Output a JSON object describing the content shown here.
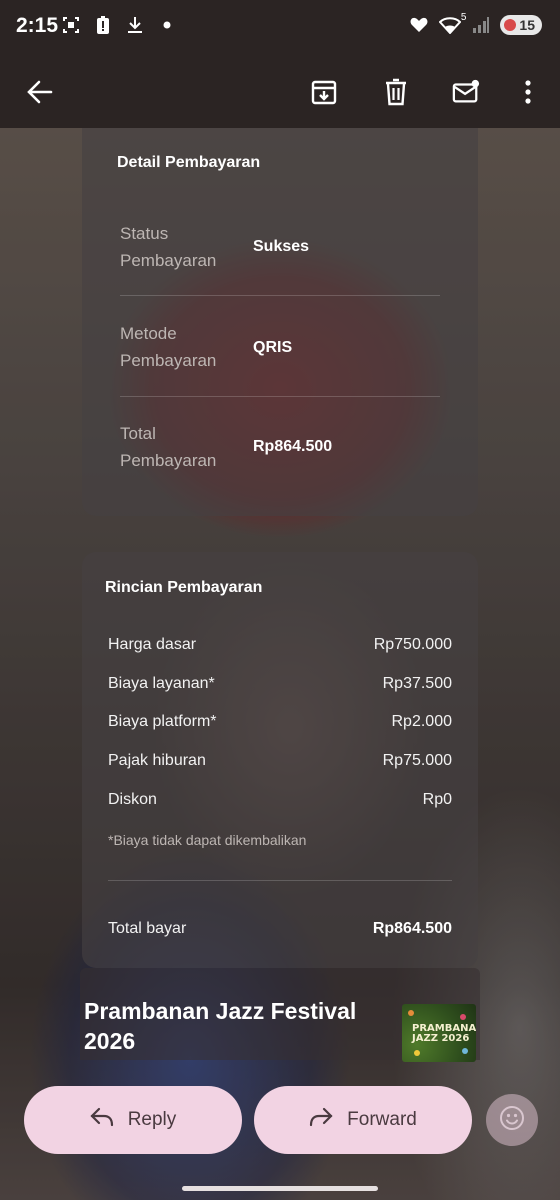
{
  "status_bar": {
    "time": "2:15",
    "battery_level": "15",
    "wifi_label": "5",
    "icons": [
      "screenshot-icon",
      "alert-battery-icon",
      "download-icon",
      "notification-dot",
      "heart-icon",
      "wifi-icon",
      "signal-icon",
      "battery-icon"
    ]
  },
  "app_bar": {
    "icons": [
      "back-arrow-icon",
      "archive-icon",
      "delete-icon",
      "mark-unread-icon",
      "more-vert-icon"
    ]
  },
  "payment_detail": {
    "title": "Detail Pembayaran",
    "rows": [
      {
        "label": "Status Pembayaran",
        "value": "Sukses"
      },
      {
        "label": "Metode Pembayaran",
        "value": "QRIS"
      },
      {
        "label": "Total Pembayaran",
        "value": "Rp864.500"
      }
    ]
  },
  "payment_breakdown": {
    "title": "Rincian Pembayaran",
    "items": [
      {
        "label": "Harga dasar",
        "value": "Rp750.000"
      },
      {
        "label": "Biaya layanan*",
        "value": "Rp37.500"
      },
      {
        "label": "Biaya platform*",
        "value": "Rp2.000"
      },
      {
        "label": "Pajak hiburan",
        "value": "Rp75.000"
      },
      {
        "label": "Diskon",
        "value": "Rp0"
      }
    ],
    "note": "*Biaya tidak dapat dikembalikan",
    "total_label": "Total bayar",
    "total_value": "Rp864.500"
  },
  "event": {
    "title": "Prambanan Jazz Festival 2026",
    "thumb_text_line1": "PRAMBANAN",
    "thumb_text_line2": "JAZZ 2026"
  },
  "actions": {
    "reply_label": "Reply",
    "forward_label": "Forward"
  },
  "colors": {
    "app_bar_bg": "#2b2423",
    "button_bg": "#f2d3e3",
    "card_bg": "rgba(70,64,66,0.62)"
  }
}
